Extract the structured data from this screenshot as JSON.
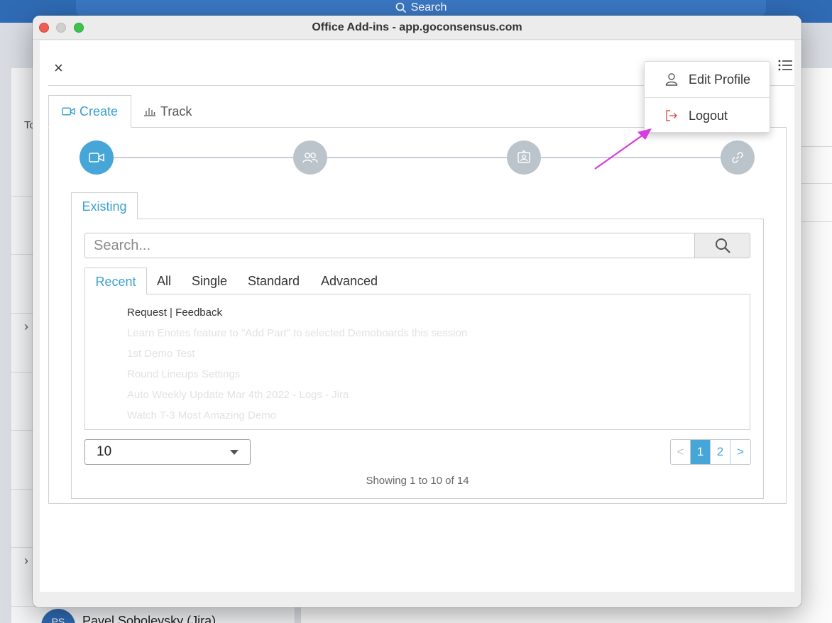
{
  "background": {
    "search_label": "Search",
    "left_label_fragment": "To",
    "user_initials": "PS",
    "user_name": "Pavel Sobolevsky (Jira)"
  },
  "window": {
    "title": "Office Add-ins - app.goconsensus.com",
    "close_glyph": "×"
  },
  "tabs": [
    {
      "label": "Create",
      "icon": "video-camera-icon",
      "active": true
    },
    {
      "label": "Track",
      "icon": "bar-chart-icon",
      "active": false
    }
  ],
  "stepper": {
    "steps": [
      {
        "icon": "video-camera-icon",
        "active": true
      },
      {
        "icon": "users-icon",
        "active": false
      },
      {
        "icon": "contact-card-icon",
        "active": false
      },
      {
        "icon": "link-icon",
        "active": false
      }
    ]
  },
  "existing": {
    "tab_label": "Existing",
    "search": {
      "placeholder": "Search...",
      "value": ""
    },
    "sub_tabs": [
      "Recent",
      "All",
      "Single",
      "Standard",
      "Advanced"
    ],
    "active_sub_tab": "Recent",
    "items": [
      "Request | Feedback",
      "Learn Enotes feature to \"Add Part\" to selected Demoboards this session",
      "1st Demo Test",
      "Round Lineups Settings",
      "Auto Weekly Update Mar 4th 2022 - Logs - Jira",
      "Watch T-3 Most Amazing Demo"
    ],
    "page_size": "10",
    "pagination": {
      "prev": "<",
      "pages": [
        "1",
        "2"
      ],
      "current": "1",
      "next": ">"
    },
    "showing_text": "Showing 1 to 10 of 14"
  },
  "dropdown_menu": {
    "items": [
      {
        "label": "Edit Profile",
        "icon": "user-icon"
      },
      {
        "label": "Logout",
        "icon": "logout-icon"
      }
    ]
  },
  "colors": {
    "accent": "#47a6d8",
    "logout_icon": "#d9534f",
    "annotation_arrow": "#d63ce0"
  }
}
